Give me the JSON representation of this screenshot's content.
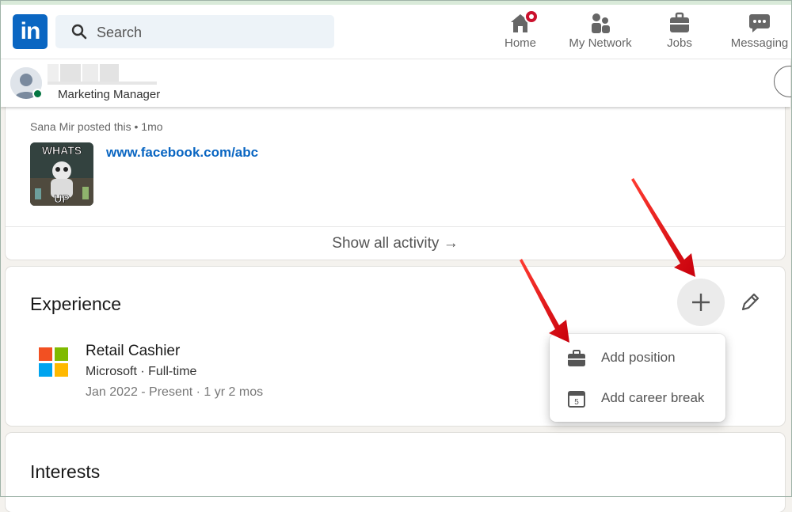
{
  "nav": {
    "search_placeholder": "Search",
    "items": [
      {
        "label": "Home",
        "icon": "home-icon"
      },
      {
        "label": "My Network",
        "icon": "network-icon"
      },
      {
        "label": "Jobs",
        "icon": "briefcase-icon"
      },
      {
        "label": "Messaging",
        "icon": "messaging-icon"
      }
    ]
  },
  "profile_bar": {
    "headline": "Marketing Manager"
  },
  "activity": {
    "meta": "Sana Mir posted this • 1mo",
    "thumbnail_text_top": "WHATS",
    "thumbnail_text_bottom": "UP",
    "link_text": "www.facebook.com/abc",
    "show_all_label": "Show all activity →"
  },
  "experience": {
    "title": "Experience",
    "entries": [
      {
        "title": "Retail Cashier",
        "company": "Microsoft · Full-time",
        "dates": "Jan 2022 - Present · 1 yr 2 mos"
      }
    ],
    "menu": [
      {
        "label": "Add position",
        "icon": "briefcase-icon"
      },
      {
        "label": "Add career break",
        "icon": "calendar-icon",
        "icon_text": "5"
      }
    ]
  },
  "interests": {
    "title": "Interests"
  },
  "colors": {
    "brand": "#0a66c2",
    "annotation_arrow": "#e3101a",
    "presence": "#057642",
    "notification": "#cb112d"
  }
}
